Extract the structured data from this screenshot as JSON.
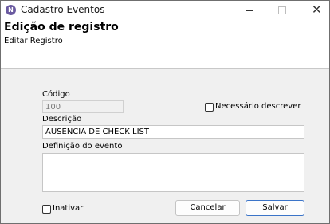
{
  "window": {
    "title": "Cadastro Eventos",
    "app_icon_glyph": "N"
  },
  "header": {
    "title": "Edição de registro",
    "subtitle": "Editar Registro"
  },
  "form": {
    "codigo_label": "Código",
    "codigo_value": "100",
    "necessario_label": "Necessário descrever",
    "descricao_label": "Descrição",
    "descricao_value": "AUSENCIA DE CHECK LIST",
    "definicao_label": "Definição do evento",
    "definicao_value": "",
    "inativar_label": "Inativar"
  },
  "buttons": {
    "cancel": "Cancelar",
    "save": "Salvar"
  },
  "colors": {
    "accent": "#3b74c8",
    "app_icon": "#6a5aa0"
  }
}
